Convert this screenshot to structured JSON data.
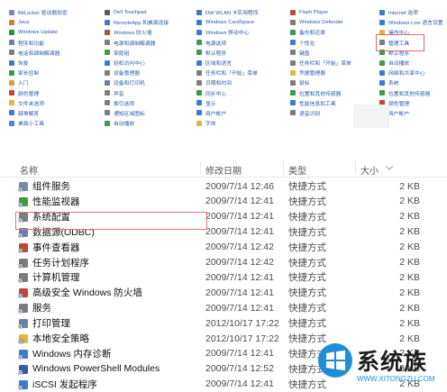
{
  "control_panel": {
    "columns": [
      {
        "items": [
          {
            "label": "BitLocker 驱动器加密",
            "color": "#7b8aa6"
          },
          {
            "label": "Java",
            "color": "#e37a2a"
          },
          {
            "label": "Windows Update",
            "color": "#2f8f3f"
          },
          {
            "label": "程序和功能",
            "color": "#6b7fb0"
          },
          {
            "label": "电话和调制解调器",
            "color": "#7d7d7d"
          },
          {
            "label": "恢复",
            "color": "#3a7bd5"
          },
          {
            "label": "家长控制",
            "color": "#3c9a4a"
          },
          {
            "label": "入门",
            "color": "#d1a23a"
          },
          {
            "label": "颜色管理",
            "color": "#c0463c"
          },
          {
            "label": "文件夹选项",
            "color": "#e0b640"
          },
          {
            "label": "疑难解答",
            "color": "#3a7bd5"
          },
          {
            "label": "桌面小工具",
            "color": "#4f88c9"
          }
        ]
      },
      {
        "items": [
          {
            "label": "Dell Touchpad",
            "color": "#5a5a5a"
          },
          {
            "label": "RemoteApp 和桌面连接",
            "color": "#3a7bd5"
          },
          {
            "label": "Windows 防火墙",
            "color": "#c0463c"
          },
          {
            "label": "电源和调制解调器",
            "color": "#7d7d7d"
          },
          {
            "label": "家庭组",
            "color": "#3c9a4a"
          },
          {
            "label": "轻松访问中心",
            "color": "#3a7bd5"
          },
          {
            "label": "设备管理器",
            "color": "#7d7d7d"
          },
          {
            "label": "设备和打印机",
            "color": "#6b7fb0"
          },
          {
            "label": "声音",
            "color": "#7d7d7d"
          },
          {
            "label": "索引选项",
            "color": "#7d7d7d"
          },
          {
            "label": "通知区域图标",
            "color": "#7d7d7d"
          },
          {
            "label": "自动播放",
            "color": "#3c9a4a"
          }
        ]
      },
      {
        "items": [
          {
            "label": "DW WLAN 卡实用程序",
            "color": "#3a7bd5"
          },
          {
            "label": "Windows CardSpace",
            "color": "#3a7bd5"
          },
          {
            "label": "Windows 移动中心",
            "color": "#3a7bd5"
          },
          {
            "label": "电源选项",
            "color": "#3c9a4a"
          },
          {
            "label": "默认程序",
            "color": "#3c9a4a"
          },
          {
            "label": "区域和语言",
            "color": "#3a7bd5"
          },
          {
            "label": "任务栏和「开始」菜单",
            "color": "#7d7d7d"
          },
          {
            "label": "日期和时间",
            "color": "#7d7d7d"
          },
          {
            "label": "同步中心",
            "color": "#3c9a4a"
          },
          {
            "label": "显示",
            "color": "#3a7bd5"
          },
          {
            "label": "用户帐户",
            "color": "#3a7bd5"
          },
          {
            "label": "字体",
            "color": "#e0b640"
          }
        ]
      },
      {
        "items": [
          {
            "label": "Flash Player",
            "color": "#c0463c"
          },
          {
            "label": "Windows Defender",
            "color": "#7d7d7d"
          },
          {
            "label": "备份和还原",
            "color": "#3c9a4a"
          },
          {
            "label": "个性化",
            "color": "#3a7bd5"
          },
          {
            "label": "键盘",
            "color": "#7d7d7d"
          },
          {
            "label": "任务栏和「开始」菜单",
            "color": "#7d7d7d"
          },
          {
            "label": "凭据管理器",
            "color": "#e0b640"
          },
          {
            "label": "鼠标",
            "color": "#7d7d7d"
          },
          {
            "label": "位置和其他传感器",
            "color": "#3c9a4a"
          },
          {
            "label": "性能信息和工具",
            "color": "#3a7bd5"
          },
          {
            "label": "语音识别",
            "color": "#7d7d7d"
          },
          {
            "label": "",
            "color": "#ffffff"
          }
        ]
      },
      {
        "items": [
          {
            "label": "Internet 选项",
            "color": "#3a7bd5"
          },
          {
            "label": "Windows Live 语言设置",
            "color": "#3a7bd5"
          },
          {
            "label": "操作中心",
            "color": "#e0b640"
          },
          {
            "label": "管理工具",
            "color": "#7d7d7d"
          },
          {
            "label": "默认程序",
            "color": "#3c9a4a"
          },
          {
            "label": "自动播放",
            "color": "#3c9a4a"
          },
          {
            "label": "网络和共享中心",
            "color": "#3a7bd5"
          },
          {
            "label": "系统",
            "color": "#3a7bd5"
          },
          {
            "label": "位置和其他传感器",
            "color": "#3c9a4a"
          },
          {
            "label": "颜色管理",
            "color": "#c0463c"
          },
          {
            "label": "用户帐户",
            "color": "#3a7bd5"
          },
          {
            "label": "",
            "color": "#ffffff"
          }
        ]
      }
    ]
  },
  "explorer": {
    "headers": {
      "name": "名称",
      "date": "修改日期",
      "type": "类型",
      "size": "大小"
    },
    "rows": [
      {
        "name": "组件服务",
        "date": "2009/7/14 12:46",
        "type": "快捷方式",
        "size": "2 KB",
        "icon": "#7b8aa6"
      },
      {
        "name": "性能监视器",
        "date": "2009/7/14 12:41",
        "type": "快捷方式",
        "size": "2 KB",
        "icon": "#3c9a4a"
      },
      {
        "name": "系统配置",
        "date": "2009/7/14 12:41",
        "type": "快捷方式",
        "size": "2 KB",
        "icon": "#7d7d7d"
      },
      {
        "name": "数据源(ODBC)",
        "date": "2009/7/14 12:41",
        "type": "快捷方式",
        "size": "2 KB",
        "icon": "#6b7fb0"
      },
      {
        "name": "事件查看器",
        "date": "2009/7/14 12:42",
        "type": "快捷方式",
        "size": "2 KB",
        "icon": "#c0463c"
      },
      {
        "name": "任务计划程序",
        "date": "2009/7/14 12:42",
        "type": "快捷方式",
        "size": "2 KB",
        "icon": "#7d7d7d"
      },
      {
        "name": "计算机管理",
        "date": "2009/7/14 12:41",
        "type": "快捷方式",
        "size": "2 KB",
        "icon": "#7d7d7d"
      },
      {
        "name": "高级安全 Windows 防火墙",
        "date": "2009/7/14 12:41",
        "type": "快捷方式",
        "size": "2 KB",
        "icon": "#c0463c"
      },
      {
        "name": "服务",
        "date": "2009/7/14 12:41",
        "type": "快捷方式",
        "size": "2 KB",
        "icon": "#7d7d7d"
      },
      {
        "name": "打印管理",
        "date": "2012/10/17 17:22",
        "type": "快捷方式",
        "size": "2 KB",
        "icon": "#6b7fb0"
      },
      {
        "name": "本地安全策略",
        "date": "2012/10/17 17:22",
        "type": "快捷方式",
        "size": "2 KB",
        "icon": "#e0b640"
      },
      {
        "name": "Windows 内存诊断",
        "date": "2009/7/14 12:41",
        "type": "快捷方式",
        "size": "2 KB",
        "icon": "#3a7bd5"
      },
      {
        "name": "Windows PowerShell Modules",
        "date": "2009/7/14 12:52",
        "type": "快捷方式",
        "size": "3 KB",
        "icon": "#2f5fa8"
      },
      {
        "name": "iSCSI 发起程序",
        "date": "2009/7/14 12:41",
        "type": "快捷方式",
        "size": "2 KB",
        "icon": "#3a7bd5"
      }
    ]
  },
  "watermark": {
    "brand": "系统族",
    "url": "WWW.XITONGZU.COM",
    "accent": "#1e8fd6"
  }
}
